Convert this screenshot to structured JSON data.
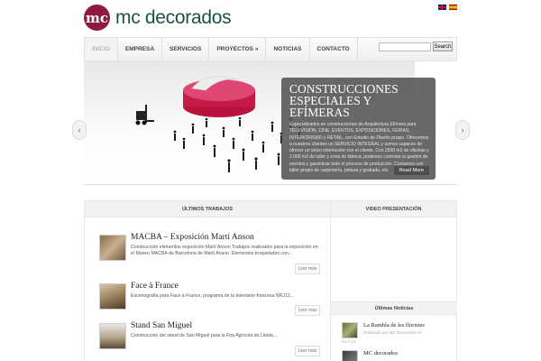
{
  "brand": {
    "logo_mark": "mc",
    "logo_text": "mc decorados"
  },
  "languages": [
    {
      "code": "en",
      "icon": "uk-flag-icon"
    },
    {
      "code": "es",
      "icon": "spain-flag-icon"
    }
  ],
  "nav": {
    "items": [
      {
        "label": "INICIO",
        "active": true
      },
      {
        "label": "EMPRESA"
      },
      {
        "label": "SERVICIOS"
      },
      {
        "label": "PROYECTOS »"
      },
      {
        "label": "NOTICIAS"
      },
      {
        "label": "CONTACTO"
      }
    ]
  },
  "search": {
    "value": "",
    "button_label": "Search"
  },
  "slider": {
    "title": "CONSTRUCCIONES ESPECIALES Y EFÍMERAS",
    "text": "Especializados en construcciones de Arquitectura Efímera para TELEVISIÓN, CINE, EVENTOS, EXPOSICIONES, FERIAS, INTERIORISMO y RETAIL, con Estudio de Diseño propio. Ofrecemos a nuestros clientes un SERVICIO INTEGRAL y somos capaces de ofrecer un único interlocutor con el cliente. Con 2500 m2 de oficinas y 2.000 m2 de taller y zona de fábrica, podemos controlar la gestión de eventos y garantizar todo el proceso de producción. Contamos con taller propio de carpintería, pintura y grabado, etc.",
    "read_more": "Read More",
    "prev_icon": "chevron-left-icon",
    "next_icon": "chevron-right-icon"
  },
  "works": {
    "heading": "ÚLTIMOS TRABAJOS",
    "items": [
      {
        "title": "MACBA – Exposición Martí Anson",
        "text": "Construcción elementos exposición Martí Anson Trabajos realizados para la exposición en el Museu MACBA de Barcelona de Martí Anson. Elementos troquelados con...",
        "more": "Leer más"
      },
      {
        "title": "Face à France",
        "text": "Escenografía para Face à France, programa de la televisión francesa NRJ12...",
        "more": "Leer más"
      },
      {
        "title": "Stand San Miguel",
        "text": "Construcción del stand de San Miguel para la Fira Agrícola de Lleida....",
        "more": "Leer más"
      }
    ]
  },
  "video": {
    "heading": "VIDEO PRESENTACIÓN"
  },
  "news": {
    "heading": "Últimas Noticias",
    "items": [
      {
        "title": "La Rambla de les floristes",
        "meta": "Publicado por MC Decorados en",
        "date": "24-7-13"
      },
      {
        "title": "MC decorados"
      }
    ]
  }
}
